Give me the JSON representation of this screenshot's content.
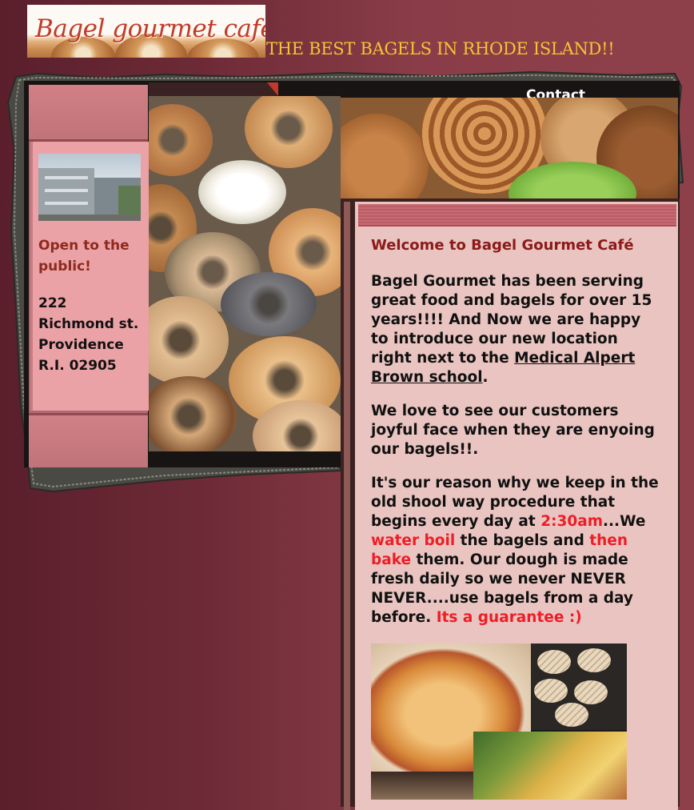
{
  "header": {
    "logo_text": "Bagel gourmet cafe",
    "tagline": "THE BEST BAGELS IN RHODE ISLAND!!"
  },
  "nav": {
    "contact": "Contact"
  },
  "sidebar": {
    "open_text": "Open to the public!",
    "address": "222 Richmond st. Providence R.I. 02905"
  },
  "content": {
    "welcome": "Welcome to Bagel Gourmet Café",
    "p1_a": "Bagel Gourmet has been serving great food and bagels for over 15 years!!!! And Now we are happy to introduce our new location right next to the ",
    "p1_link": "Medical Alpert Brown school",
    "p1_b": ".",
    "p2": "We love to see our customers joyful face when they are enyoing our bagels!!.",
    "p3_a": "It's our reason why we keep in the old shool way procedure that begins every day at ",
    "p3_time": "2:30am",
    "p3_b": "...We ",
    "p3_boil": "water boil",
    "p3_c": " the bagels and ",
    "p3_bake": "then bake",
    "p3_d": " them. Our dough is made fresh daily so we never NEVER NEVER....use bagels from a day before. ",
    "p3_guarantee": "Its a guarantee :)"
  },
  "colors": {
    "accent_red": "#ee1d26",
    "title_red": "#8b1a1a",
    "tagline_gold": "#f3c535",
    "panel_pink": "#e9c4c0",
    "sidebar_pink": "#eba2a6"
  }
}
